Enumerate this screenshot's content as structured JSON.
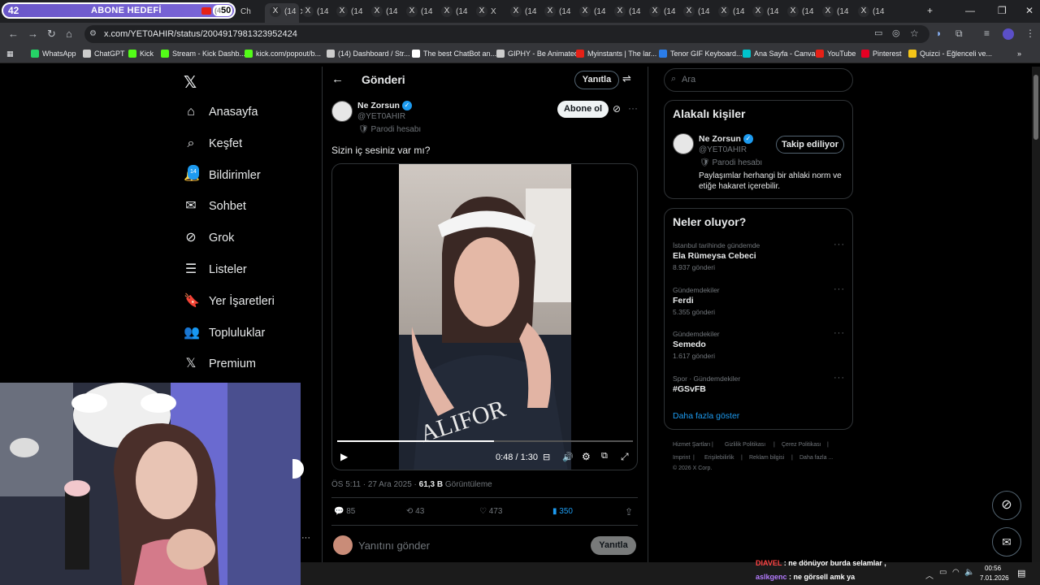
{
  "browser": {
    "goal_widget": {
      "number": "42",
      "label": "ABONE HEDEFİ",
      "count": "50",
      "extra": "(4"
    },
    "tabs": [
      {
        "label": "Ch"
      },
      {
        "label": "(14"
      },
      {
        "label": "(14"
      },
      {
        "label": "(14"
      },
      {
        "label": "(14"
      },
      {
        "label": "(14"
      },
      {
        "label": "(14"
      },
      {
        "label": "X"
      },
      {
        "label": "(14"
      },
      {
        "label": "(14"
      },
      {
        "label": "(14"
      },
      {
        "label": "(14"
      },
      {
        "label": "(14"
      },
      {
        "label": "(14"
      },
      {
        "label": "(14"
      },
      {
        "label": "(14"
      },
      {
        "label": "(14"
      },
      {
        "label": "(14"
      },
      {
        "label": "(14"
      }
    ],
    "url": "x.com/YET0AHIR/status/2004917981323952424",
    "bookmarks": [
      {
        "label": "WhatsApp",
        "color": "#25d366"
      },
      {
        "label": "ChatGPT",
        "color": "#cccccc"
      },
      {
        "label": "Kick",
        "color": "#53fc18"
      },
      {
        "label": "Stream - Kick Dashb...",
        "color": "#53fc18"
      },
      {
        "label": "kick.com/popout/b...",
        "color": "#53fc18"
      },
      {
        "label": "(14) Dashboard / Str...",
        "color": "#cccccc"
      },
      {
        "label": "The best ChatBot an...",
        "color": "#ffffff"
      },
      {
        "label": "GIPHY - Be Animated",
        "color": "#cccccc"
      },
      {
        "label": "Myinstants | The lar...",
        "color": "#e62117"
      },
      {
        "label": "Tenor GIF Keyboard...",
        "color": "#2b7de9"
      },
      {
        "label": "Ana Sayfa - Canva",
        "color": "#00c4cc"
      },
      {
        "label": "YouTube",
        "color": "#e62117"
      },
      {
        "label": "Pinterest",
        "color": "#e60023"
      },
      {
        "label": "Quizci - Eğlenceli ve...",
        "color": "#f5c518"
      }
    ]
  },
  "sidebar": {
    "items": [
      {
        "label": "Anasayfa",
        "icon": "home-icon"
      },
      {
        "label": "Keşfet",
        "icon": "search-icon"
      },
      {
        "label": "Bildirimler",
        "icon": "bell-icon",
        "badge": "14"
      },
      {
        "label": "Sohbet",
        "icon": "mail-icon"
      },
      {
        "label": "Grok",
        "icon": "grok-icon"
      },
      {
        "label": "Listeler",
        "icon": "list-icon"
      },
      {
        "label": "Yer İşaretleri",
        "icon": "bookmark-icon"
      },
      {
        "label": "Topluluklar",
        "icon": "communities-icon"
      },
      {
        "label": "Premium",
        "icon": "x-logo-icon"
      }
    ]
  },
  "post": {
    "header_title": "Gönderi",
    "reply_btn": "Yanıtla",
    "author_name": "Ne Zorsun",
    "author_handle": "@YET0AHIR",
    "parody_label": "Parodi hesabı",
    "follow_btn": "Abone ol",
    "text": "Sizin iç sesiniz var mı?",
    "video": {
      "time": "0:48 / 1:30",
      "progress": 0.53
    },
    "meta_time": "ÖS 5:11 · 27 Ara 2025 · ",
    "views_count": "61,3 B",
    "views_label": "Görüntüleme",
    "stats": {
      "replies": "85",
      "reposts": "43",
      "likes": "473",
      "bookmarks": "350"
    },
    "reply_placeholder": "Yanıtını gönder",
    "reply_submit": "Yanıtla"
  },
  "right": {
    "search_placeholder": "Ara",
    "relevant_title": "Alakalı kişiler",
    "relevant": {
      "name": "Ne Zorsun",
      "handle": "@YET0AHIR",
      "parody": "Parodi hesabı",
      "follow_btn": "Takip ediliyor",
      "bio": "Paylaşımlar herhangi bir ahlaki norm ve etiğe hakaret içerebilir."
    },
    "trends_title": "Neler oluyor?",
    "trends": [
      {
        "category": "İstanbul tarihinde gündemde",
        "name": "Ela Rümeysa Cebeci",
        "count": "8.937 gönderi"
      },
      {
        "category": "Gündemdekiler",
        "name": "Ferdi",
        "count": "5.355 gönderi"
      },
      {
        "category": "Gündemdekiler",
        "name": "Semedo",
        "count": "1.617 gönderi"
      },
      {
        "category": "Spor · Gündemdekiler",
        "name": "#GSvFB",
        "count": ""
      }
    ],
    "show_more": "Daha fazla göster",
    "footer": [
      "Hizmet Şartları",
      "|",
      "Gizlilik Politikası",
      "|",
      "Çerez Politikası",
      "|",
      "Imprint",
      "|",
      "Erişilebilirlik",
      "|",
      "Reklam bilgisi",
      "|",
      "Daha fazla ...",
      "© 2026 X Corp."
    ]
  },
  "chat": [
    {
      "user": "DIAVEL",
      "text": ": ne dönüyor burda selamlar ,",
      "color": "#ff4444"
    },
    {
      "user": "aslkgenc",
      "text": ": ne görsell amk ya",
      "color": "#b57cff"
    }
  ],
  "taskbar": {
    "time": "00:56",
    "date": "7.01.2026"
  }
}
